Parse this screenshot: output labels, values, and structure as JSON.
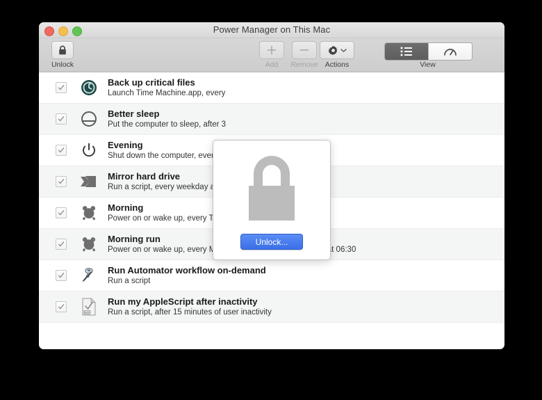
{
  "window": {
    "title": "Power Manager on This Mac",
    "traffic_lights": {
      "close": "close-button",
      "minimize": "minimize-button",
      "zoom": "zoom-button",
      "close_color": "#ec6a5f",
      "minimize_color": "#f5bf4f",
      "zoom_color": "#61c555"
    }
  },
  "toolbar": {
    "unlock": {
      "label": "Unlock",
      "icon": "lock-closed-icon",
      "enabled": true
    },
    "add": {
      "label": "Add",
      "icon": "plus-icon",
      "enabled": false
    },
    "remove": {
      "label": "Remove",
      "icon": "minus-icon",
      "enabled": false
    },
    "actions": {
      "label": "Actions",
      "icon": "gear-icon",
      "enabled": true
    },
    "view": {
      "label": "View",
      "segments": [
        {
          "name": "list-view",
          "icon": "list-icon",
          "selected": true
        },
        {
          "name": "gauge-view",
          "icon": "gauge-icon",
          "selected": false
        }
      ]
    }
  },
  "schedules": [
    {
      "checked": true,
      "icon": "time-machine-icon",
      "title": "Back up critical files",
      "subtitle": "Launch Time Machine.app, every"
    },
    {
      "checked": true,
      "icon": "sleep-icon",
      "title": "Better sleep",
      "subtitle": "Put the computer to sleep, after 3"
    },
    {
      "checked": true,
      "icon": "power-icon",
      "title": "Evening",
      "subtitle": "Shut down the computer, every w"
    },
    {
      "checked": true,
      "icon": "script-terminal-icon",
      "title": "Mirror hard drive",
      "subtitle": "Run a script, every weekday at 17:"
    },
    {
      "checked": true,
      "icon": "alarm-clock-icon",
      "title": "Morning",
      "subtitle": "Power on or wake up, every Tuesday and Thursday at 07:05"
    },
    {
      "checked": true,
      "icon": "alarm-clock-icon",
      "title": "Morning run",
      "subtitle": "Power on or wake up, every Monday, Wednesday, and Friday at 06:30"
    },
    {
      "checked": true,
      "icon": "automator-robot-icon",
      "title": "Run Automator workflow on-demand",
      "subtitle": "Run a script"
    },
    {
      "checked": true,
      "icon": "applescript-document-icon",
      "title": "Run my AppleScript after inactivity",
      "subtitle": "Run a script, after 15 minutes of user inactivity"
    }
  ],
  "unlock_dialog": {
    "icon": "large-lock-icon",
    "button_label": "Unlock...",
    "button_color": "#3a6fe8",
    "lock_color": "#bcbcbc"
  }
}
